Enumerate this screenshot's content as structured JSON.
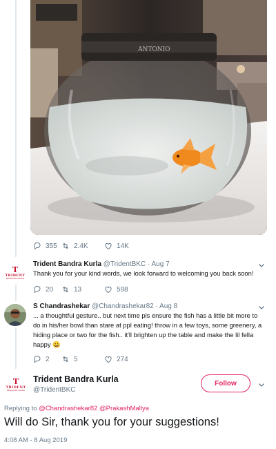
{
  "tweet1": {
    "image_text": "ANTONIO",
    "stats": {
      "replies": "355",
      "retweets": "2.4K",
      "likes": "14K"
    }
  },
  "tweet2": {
    "name": "Trident Bandra Kurla",
    "handle": "@TridentBKC",
    "time": "· Aug 7",
    "text": "Thank you for your kind words, we look forward to welcoming you back soon!",
    "logo": {
      "mark": "T",
      "word": "TRIDENT",
      "sub": "Bandra Kurla, Mumbai"
    },
    "stats": {
      "replies": "20",
      "retweets": "13",
      "likes": "598"
    }
  },
  "tweet3": {
    "name": "S Chandrashekar",
    "handle": "@Chandrashekar82",
    "time": "· Aug 8",
    "text_lines": [
      "... a thoughtful gesture.. but next time pls ensure the fish has a little bit more to",
      "do in his/her bowl than stare at ppl eating! throw in a few toys, some greenery, a",
      "hiding place or two for the fish.. it'll brighten up the table and make the lil fella",
      "happy"
    ],
    "emoji": "😀",
    "stats": {
      "replies": "2",
      "retweets": "5",
      "likes": "274"
    }
  },
  "main": {
    "name": "Trident Bandra Kurla",
    "handle": "@TridentBKC",
    "logo": {
      "mark": "T",
      "word": "TRIDENT",
      "sub": "Bandra Kurla, Mumbai"
    },
    "follow_label": "Follow",
    "replying_prefix": "Replying to",
    "mention1": "@Chandrashekar82",
    "mention2": "@PrakashMallya",
    "text": "Will do Sir, thank you for your suggestions!",
    "timestamp": "4:08 AM - 8 Aug 2019"
  },
  "colors": {
    "accent": "#e0245e",
    "brand_red": "#c8102e",
    "muted": "#657786",
    "text": "#14171a"
  },
  "icons": [
    "reply-icon",
    "retweet-icon",
    "like-icon",
    "chevron-down-icon"
  ]
}
